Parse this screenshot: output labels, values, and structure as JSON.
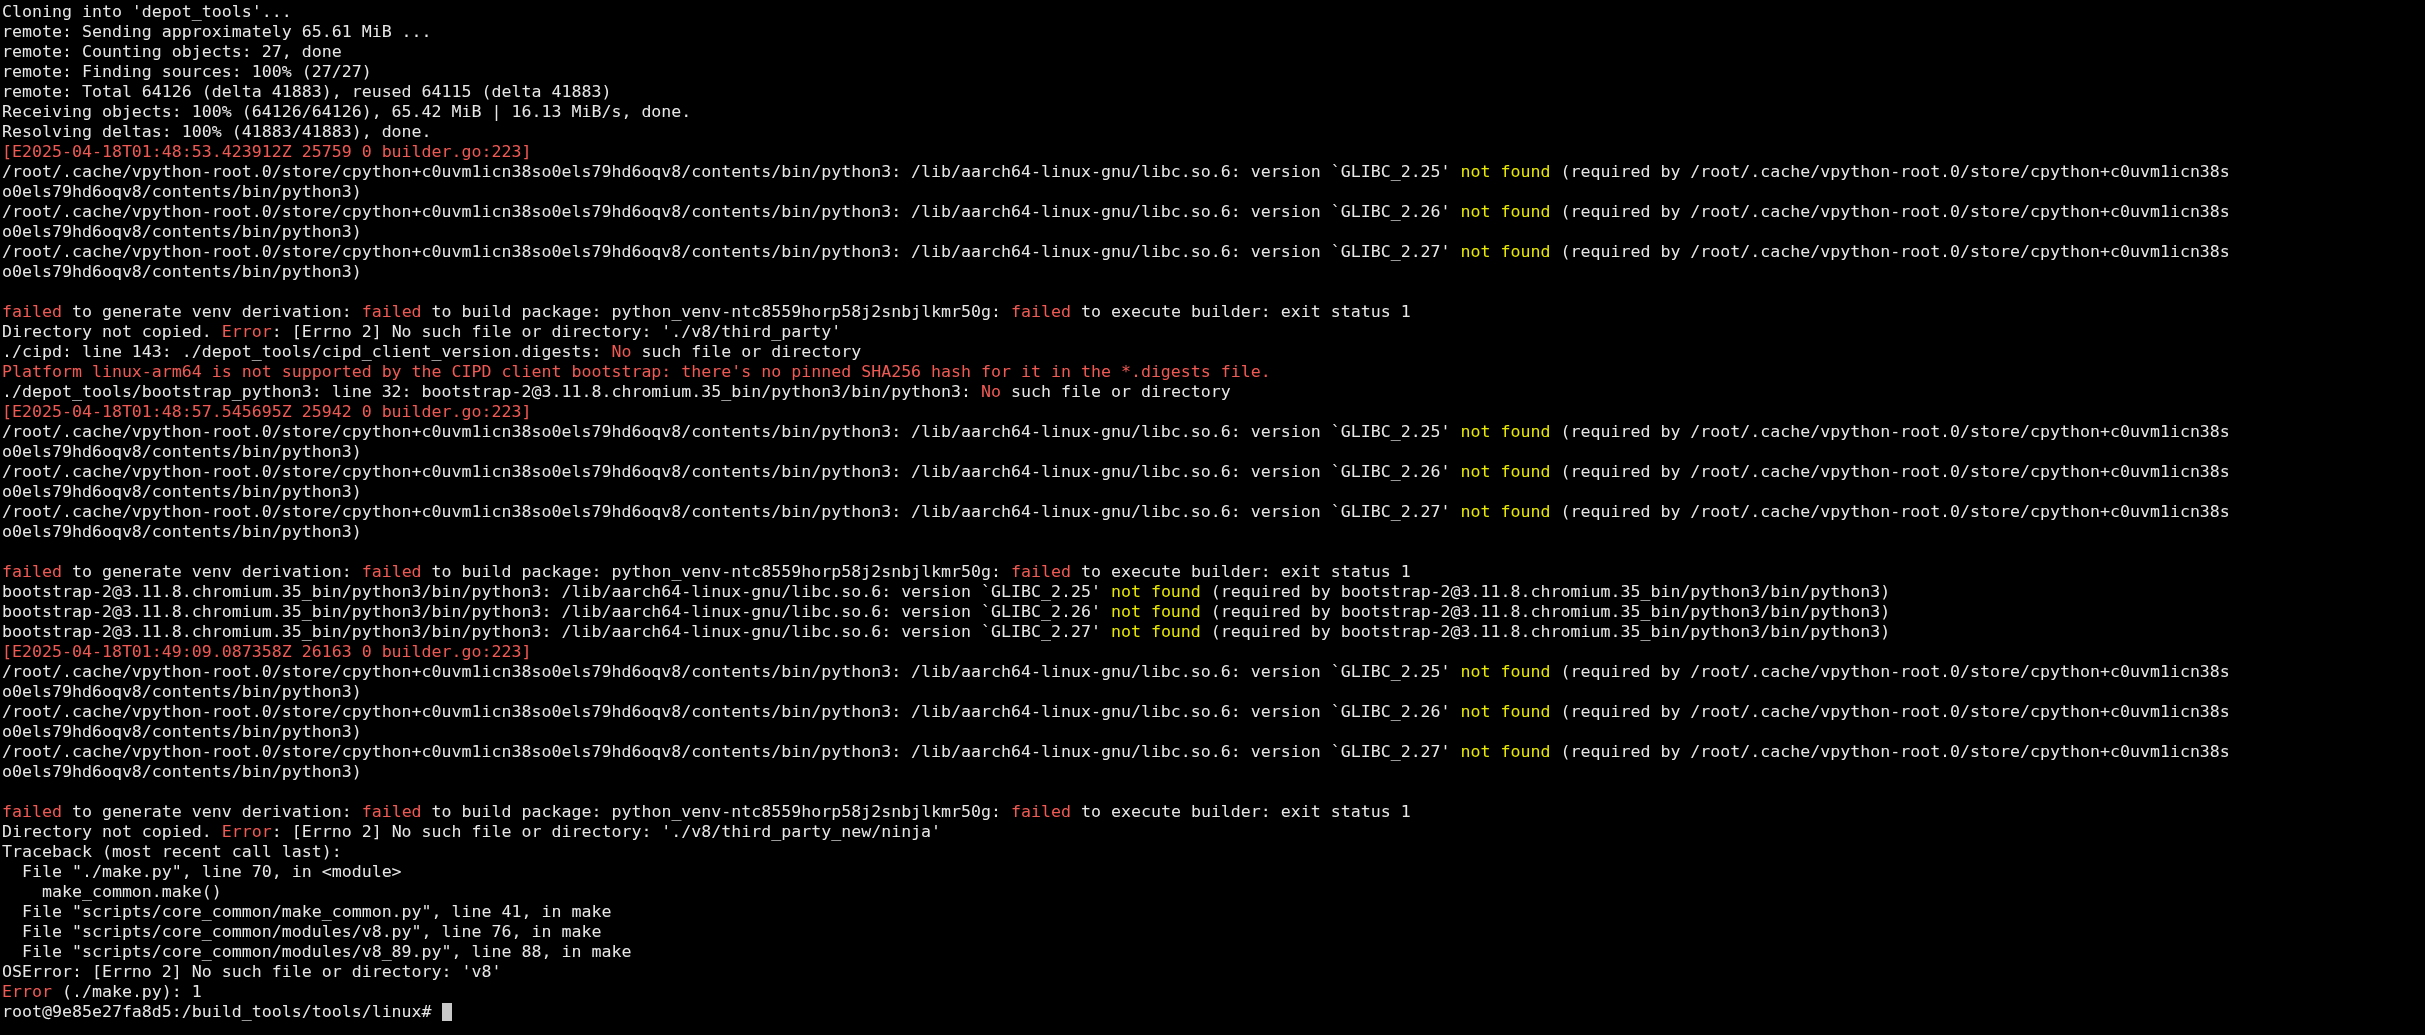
{
  "terminal": {
    "lines": [
      {
        "kind": "text",
        "segments": [
          {
            "kind": "plain",
            "text": "Cloning into 'depot_tools'..."
          }
        ]
      },
      {
        "kind": "text",
        "segments": [
          {
            "kind": "plain",
            "text": "remote: Sending approximately 65.61 MiB ..."
          }
        ]
      },
      {
        "kind": "text",
        "segments": [
          {
            "kind": "plain",
            "text": "remote: Counting objects: 27, done"
          }
        ]
      },
      {
        "kind": "text",
        "segments": [
          {
            "kind": "plain",
            "text": "remote: Finding sources: 100% (27/27)"
          }
        ]
      },
      {
        "kind": "text",
        "segments": [
          {
            "kind": "plain",
            "text": "remote: Total 64126 (delta 41883), reused 64115 (delta 41883)"
          }
        ]
      },
      {
        "kind": "text",
        "segments": [
          {
            "kind": "plain",
            "text": "Receiving objects: 100% (64126/64126), 65.42 MiB | 16.13 MiB/s, done."
          }
        ]
      },
      {
        "kind": "text",
        "segments": [
          {
            "kind": "plain",
            "text": "Resolving deltas: 100% (41883/41883), done."
          }
        ]
      },
      {
        "kind": "text",
        "segments": [
          {
            "kind": "error",
            "text": "[E2025-04-18T01:48:53.423912Z 25759 0 builder.go:223]"
          }
        ]
      },
      {
        "kind": "text",
        "segments": [
          {
            "kind": "plain",
            "text": "/root/.cache/vpython-root.0/store/cpython+c0uvm1icn38so0els79hd6oqv8/contents/bin/python3: /lib/aarch64-linux-gnu/libc.so.6: version `GLIBC_2.25'"
          },
          {
            "kind": "warning",
            "text": " not found"
          },
          {
            "kind": "plain",
            "text": " (required by /root/.cache/vpython-root.0/store/cpython+c0uvm1icn38s"
          }
        ]
      },
      {
        "kind": "text",
        "segments": [
          {
            "kind": "plain",
            "text": "o0els79hd6oqv8/contents/bin/python3)"
          }
        ]
      },
      {
        "kind": "text",
        "segments": [
          {
            "kind": "plain",
            "text": "/root/.cache/vpython-root.0/store/cpython+c0uvm1icn38so0els79hd6oqv8/contents/bin/python3: /lib/aarch64-linux-gnu/libc.so.6: version `GLIBC_2.26'"
          },
          {
            "kind": "warning",
            "text": " not found"
          },
          {
            "kind": "plain",
            "text": " (required by /root/.cache/vpython-root.0/store/cpython+c0uvm1icn38s"
          }
        ]
      },
      {
        "kind": "text",
        "segments": [
          {
            "kind": "plain",
            "text": "o0els79hd6oqv8/contents/bin/python3)"
          }
        ]
      },
      {
        "kind": "text",
        "segments": [
          {
            "kind": "plain",
            "text": "/root/.cache/vpython-root.0/store/cpython+c0uvm1icn38so0els79hd6oqv8/contents/bin/python3: /lib/aarch64-linux-gnu/libc.so.6: version `GLIBC_2.27'"
          },
          {
            "kind": "warning",
            "text": " not found"
          },
          {
            "kind": "plain",
            "text": " (required by /root/.cache/vpython-root.0/store/cpython+c0uvm1icn38s"
          }
        ]
      },
      {
        "kind": "text",
        "segments": [
          {
            "kind": "plain",
            "text": "o0els79hd6oqv8/contents/bin/python3)"
          }
        ]
      },
      {
        "kind": "blank"
      },
      {
        "kind": "text",
        "segments": [
          {
            "kind": "error",
            "text": "failed"
          },
          {
            "kind": "plain",
            "text": " to generate venv derivation: "
          },
          {
            "kind": "error",
            "text": "failed"
          },
          {
            "kind": "plain",
            "text": " to build package: python_venv-ntc8559horp58j2snbjlkmr50g: "
          },
          {
            "kind": "error",
            "text": "failed"
          },
          {
            "kind": "plain",
            "text": " to execute builder: exit status 1"
          }
        ]
      },
      {
        "kind": "text",
        "segments": [
          {
            "kind": "plain",
            "text": "Directory not copied. "
          },
          {
            "kind": "error",
            "text": "Error"
          },
          {
            "kind": "plain",
            "text": ": [Errno 2] No such file or directory: './v8/third_party'"
          }
        ]
      },
      {
        "kind": "text",
        "segments": [
          {
            "kind": "plain",
            "text": "./cipd: line 143: ./depot_tools/cipd_client_version.digests: "
          },
          {
            "kind": "error",
            "text": "No"
          },
          {
            "kind": "plain",
            "text": " such file or directory"
          }
        ]
      },
      {
        "kind": "text",
        "segments": [
          {
            "kind": "error",
            "text": "Platform linux-arm64 is not supported by the CIPD client bootstrap: there's no pinned SHA256 hash for it in the *.digests file."
          }
        ]
      },
      {
        "kind": "text",
        "segments": [
          {
            "kind": "plain",
            "text": "./depot_tools/bootstrap_python3: line 32: bootstrap-2@3.11.8.chromium.35_bin/python3/bin/python3: "
          },
          {
            "kind": "error",
            "text": "No"
          },
          {
            "kind": "plain",
            "text": " such file or directory"
          }
        ]
      },
      {
        "kind": "text",
        "segments": [
          {
            "kind": "error",
            "text": "[E2025-04-18T01:48:57.545695Z 25942 0 builder.go:223]"
          }
        ]
      },
      {
        "kind": "text",
        "segments": [
          {
            "kind": "plain",
            "text": "/root/.cache/vpython-root.0/store/cpython+c0uvm1icn38so0els79hd6oqv8/contents/bin/python3: /lib/aarch64-linux-gnu/libc.so.6: version `GLIBC_2.25'"
          },
          {
            "kind": "warning",
            "text": " not found"
          },
          {
            "kind": "plain",
            "text": " (required by /root/.cache/vpython-root.0/store/cpython+c0uvm1icn38s"
          }
        ]
      },
      {
        "kind": "text",
        "segments": [
          {
            "kind": "plain",
            "text": "o0els79hd6oqv8/contents/bin/python3)"
          }
        ]
      },
      {
        "kind": "text",
        "segments": [
          {
            "kind": "plain",
            "text": "/root/.cache/vpython-root.0/store/cpython+c0uvm1icn38so0els79hd6oqv8/contents/bin/python3: /lib/aarch64-linux-gnu/libc.so.6: version `GLIBC_2.26'"
          },
          {
            "kind": "warning",
            "text": " not found"
          },
          {
            "kind": "plain",
            "text": " (required by /root/.cache/vpython-root.0/store/cpython+c0uvm1icn38s"
          }
        ]
      },
      {
        "kind": "text",
        "segments": [
          {
            "kind": "plain",
            "text": "o0els79hd6oqv8/contents/bin/python3)"
          }
        ]
      },
      {
        "kind": "text",
        "segments": [
          {
            "kind": "plain",
            "text": "/root/.cache/vpython-root.0/store/cpython+c0uvm1icn38so0els79hd6oqv8/contents/bin/python3: /lib/aarch64-linux-gnu/libc.so.6: version `GLIBC_2.27'"
          },
          {
            "kind": "warning",
            "text": " not found"
          },
          {
            "kind": "plain",
            "text": " (required by /root/.cache/vpython-root.0/store/cpython+c0uvm1icn38s"
          }
        ]
      },
      {
        "kind": "text",
        "segments": [
          {
            "kind": "plain",
            "text": "o0els79hd6oqv8/contents/bin/python3)"
          }
        ]
      },
      {
        "kind": "blank"
      },
      {
        "kind": "text",
        "segments": [
          {
            "kind": "error",
            "text": "failed"
          },
          {
            "kind": "plain",
            "text": " to generate venv derivation: "
          },
          {
            "kind": "error",
            "text": "failed"
          },
          {
            "kind": "plain",
            "text": " to build package: python_venv-ntc8559horp58j2snbjlkmr50g: "
          },
          {
            "kind": "error",
            "text": "failed"
          },
          {
            "kind": "plain",
            "text": " to execute builder: exit status 1"
          }
        ]
      },
      {
        "kind": "text",
        "segments": [
          {
            "kind": "plain",
            "text": "bootstrap-2@3.11.8.chromium.35_bin/python3/bin/python3: /lib/aarch64-linux-gnu/libc.so.6: version `GLIBC_2.25'"
          },
          {
            "kind": "warning",
            "text": " not found"
          },
          {
            "kind": "plain",
            "text": " (required by bootstrap-2@3.11.8.chromium.35_bin/python3/bin/python3)"
          }
        ]
      },
      {
        "kind": "text",
        "segments": [
          {
            "kind": "plain",
            "text": "bootstrap-2@3.11.8.chromium.35_bin/python3/bin/python3: /lib/aarch64-linux-gnu/libc.so.6: version `GLIBC_2.26'"
          },
          {
            "kind": "warning",
            "text": " not found"
          },
          {
            "kind": "plain",
            "text": " (required by bootstrap-2@3.11.8.chromium.35_bin/python3/bin/python3)"
          }
        ]
      },
      {
        "kind": "text",
        "segments": [
          {
            "kind": "plain",
            "text": "bootstrap-2@3.11.8.chromium.35_bin/python3/bin/python3: /lib/aarch64-linux-gnu/libc.so.6: version `GLIBC_2.27'"
          },
          {
            "kind": "warning",
            "text": " not found"
          },
          {
            "kind": "plain",
            "text": " (required by bootstrap-2@3.11.8.chromium.35_bin/python3/bin/python3)"
          }
        ]
      },
      {
        "kind": "text",
        "segments": [
          {
            "kind": "error",
            "text": "[E2025-04-18T01:49:09.087358Z 26163 0 builder.go:223]"
          }
        ]
      },
      {
        "kind": "text",
        "segments": [
          {
            "kind": "plain",
            "text": "/root/.cache/vpython-root.0/store/cpython+c0uvm1icn38so0els79hd6oqv8/contents/bin/python3: /lib/aarch64-linux-gnu/libc.so.6: version `GLIBC_2.25'"
          },
          {
            "kind": "warning",
            "text": " not found"
          },
          {
            "kind": "plain",
            "text": " (required by /root/.cache/vpython-root.0/store/cpython+c0uvm1icn38s"
          }
        ]
      },
      {
        "kind": "text",
        "segments": [
          {
            "kind": "plain",
            "text": "o0els79hd6oqv8/contents/bin/python3)"
          }
        ]
      },
      {
        "kind": "text",
        "segments": [
          {
            "kind": "plain",
            "text": "/root/.cache/vpython-root.0/store/cpython+c0uvm1icn38so0els79hd6oqv8/contents/bin/python3: /lib/aarch64-linux-gnu/libc.so.6: version `GLIBC_2.26'"
          },
          {
            "kind": "warning",
            "text": " not found"
          },
          {
            "kind": "plain",
            "text": " (required by /root/.cache/vpython-root.0/store/cpython+c0uvm1icn38s"
          }
        ]
      },
      {
        "kind": "text",
        "segments": [
          {
            "kind": "plain",
            "text": "o0els79hd6oqv8/contents/bin/python3)"
          }
        ]
      },
      {
        "kind": "text",
        "segments": [
          {
            "kind": "plain",
            "text": "/root/.cache/vpython-root.0/store/cpython+c0uvm1icn38so0els79hd6oqv8/contents/bin/python3: /lib/aarch64-linux-gnu/libc.so.6: version `GLIBC_2.27'"
          },
          {
            "kind": "warning",
            "text": " not found"
          },
          {
            "kind": "plain",
            "text": " (required by /root/.cache/vpython-root.0/store/cpython+c0uvm1icn38s"
          }
        ]
      },
      {
        "kind": "text",
        "segments": [
          {
            "kind": "plain",
            "text": "o0els79hd6oqv8/contents/bin/python3)"
          }
        ]
      },
      {
        "kind": "blank"
      },
      {
        "kind": "text",
        "segments": [
          {
            "kind": "error",
            "text": "failed"
          },
          {
            "kind": "plain",
            "text": " to generate venv derivation: "
          },
          {
            "kind": "error",
            "text": "failed"
          },
          {
            "kind": "plain",
            "text": " to build package: python_venv-ntc8559horp58j2snbjlkmr50g: "
          },
          {
            "kind": "error",
            "text": "failed"
          },
          {
            "kind": "plain",
            "text": " to execute builder: exit status 1"
          }
        ]
      },
      {
        "kind": "text",
        "segments": [
          {
            "kind": "plain",
            "text": "Directory not copied. "
          },
          {
            "kind": "error",
            "text": "Error"
          },
          {
            "kind": "plain",
            "text": ": [Errno 2] No such file or directory: './v8/third_party_new/ninja'"
          }
        ]
      },
      {
        "kind": "text",
        "segments": [
          {
            "kind": "plain",
            "text": "Traceback (most recent call last):"
          }
        ]
      },
      {
        "kind": "text",
        "segments": [
          {
            "kind": "plain",
            "text": "  File \"./make.py\", line 70, in <module>"
          }
        ]
      },
      {
        "kind": "text",
        "segments": [
          {
            "kind": "plain",
            "text": "    make_common.make()"
          }
        ]
      },
      {
        "kind": "text",
        "segments": [
          {
            "kind": "plain",
            "text": "  File \"scripts/core_common/make_common.py\", line 41, in make"
          }
        ]
      },
      {
        "kind": "text",
        "segments": [
          {
            "kind": "plain",
            "text": "  File \"scripts/core_common/modules/v8.py\", line 76, in make"
          }
        ]
      },
      {
        "kind": "text",
        "segments": [
          {
            "kind": "plain",
            "text": "  File \"scripts/core_common/modules/v8_89.py\", line 88, in make"
          }
        ]
      },
      {
        "kind": "text",
        "segments": [
          {
            "kind": "plain",
            "text": "OSError: [Errno 2] No such file or directory: 'v8'"
          }
        ]
      },
      {
        "kind": "text",
        "segments": [
          {
            "kind": "error",
            "text": "Error"
          },
          {
            "kind": "plain",
            "text": " (./make.py): 1"
          }
        ]
      },
      {
        "kind": "prompt",
        "segments": [
          {
            "kind": "plain",
            "text": "root@9e85e27fa8d5:/build_tools/tools/linux# "
          }
        ]
      }
    ]
  }
}
